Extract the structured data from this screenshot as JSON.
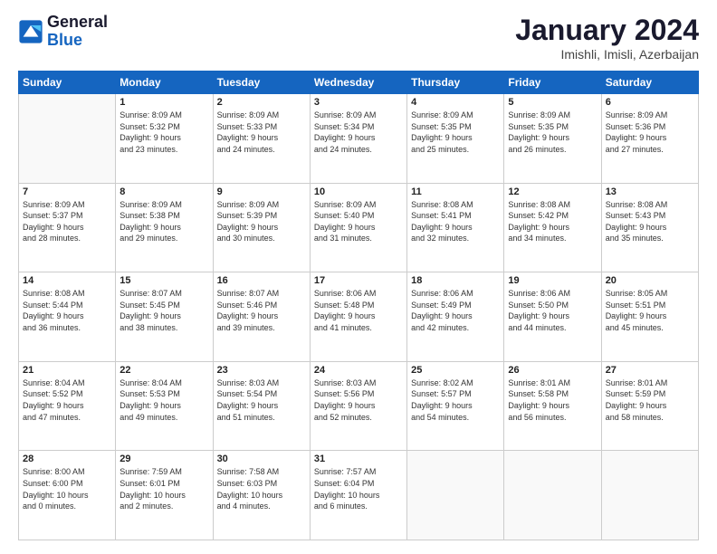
{
  "header": {
    "logo_general": "General",
    "logo_blue": "Blue",
    "month_title": "January 2024",
    "location": "Imishli, Imisli, Azerbaijan"
  },
  "days_of_week": [
    "Sunday",
    "Monday",
    "Tuesday",
    "Wednesday",
    "Thursday",
    "Friday",
    "Saturday"
  ],
  "weeks": [
    [
      {
        "day": "",
        "info": ""
      },
      {
        "day": "1",
        "info": "Sunrise: 8:09 AM\nSunset: 5:32 PM\nDaylight: 9 hours\nand 23 minutes."
      },
      {
        "day": "2",
        "info": "Sunrise: 8:09 AM\nSunset: 5:33 PM\nDaylight: 9 hours\nand 24 minutes."
      },
      {
        "day": "3",
        "info": "Sunrise: 8:09 AM\nSunset: 5:34 PM\nDaylight: 9 hours\nand 24 minutes."
      },
      {
        "day": "4",
        "info": "Sunrise: 8:09 AM\nSunset: 5:35 PM\nDaylight: 9 hours\nand 25 minutes."
      },
      {
        "day": "5",
        "info": "Sunrise: 8:09 AM\nSunset: 5:35 PM\nDaylight: 9 hours\nand 26 minutes."
      },
      {
        "day": "6",
        "info": "Sunrise: 8:09 AM\nSunset: 5:36 PM\nDaylight: 9 hours\nand 27 minutes."
      }
    ],
    [
      {
        "day": "7",
        "info": "Sunrise: 8:09 AM\nSunset: 5:37 PM\nDaylight: 9 hours\nand 28 minutes."
      },
      {
        "day": "8",
        "info": "Sunrise: 8:09 AM\nSunset: 5:38 PM\nDaylight: 9 hours\nand 29 minutes."
      },
      {
        "day": "9",
        "info": "Sunrise: 8:09 AM\nSunset: 5:39 PM\nDaylight: 9 hours\nand 30 minutes."
      },
      {
        "day": "10",
        "info": "Sunrise: 8:09 AM\nSunset: 5:40 PM\nDaylight: 9 hours\nand 31 minutes."
      },
      {
        "day": "11",
        "info": "Sunrise: 8:08 AM\nSunset: 5:41 PM\nDaylight: 9 hours\nand 32 minutes."
      },
      {
        "day": "12",
        "info": "Sunrise: 8:08 AM\nSunset: 5:42 PM\nDaylight: 9 hours\nand 34 minutes."
      },
      {
        "day": "13",
        "info": "Sunrise: 8:08 AM\nSunset: 5:43 PM\nDaylight: 9 hours\nand 35 minutes."
      }
    ],
    [
      {
        "day": "14",
        "info": "Sunrise: 8:08 AM\nSunset: 5:44 PM\nDaylight: 9 hours\nand 36 minutes."
      },
      {
        "day": "15",
        "info": "Sunrise: 8:07 AM\nSunset: 5:45 PM\nDaylight: 9 hours\nand 38 minutes."
      },
      {
        "day": "16",
        "info": "Sunrise: 8:07 AM\nSunset: 5:46 PM\nDaylight: 9 hours\nand 39 minutes."
      },
      {
        "day": "17",
        "info": "Sunrise: 8:06 AM\nSunset: 5:48 PM\nDaylight: 9 hours\nand 41 minutes."
      },
      {
        "day": "18",
        "info": "Sunrise: 8:06 AM\nSunset: 5:49 PM\nDaylight: 9 hours\nand 42 minutes."
      },
      {
        "day": "19",
        "info": "Sunrise: 8:06 AM\nSunset: 5:50 PM\nDaylight: 9 hours\nand 44 minutes."
      },
      {
        "day": "20",
        "info": "Sunrise: 8:05 AM\nSunset: 5:51 PM\nDaylight: 9 hours\nand 45 minutes."
      }
    ],
    [
      {
        "day": "21",
        "info": "Sunrise: 8:04 AM\nSunset: 5:52 PM\nDaylight: 9 hours\nand 47 minutes."
      },
      {
        "day": "22",
        "info": "Sunrise: 8:04 AM\nSunset: 5:53 PM\nDaylight: 9 hours\nand 49 minutes."
      },
      {
        "day": "23",
        "info": "Sunrise: 8:03 AM\nSunset: 5:54 PM\nDaylight: 9 hours\nand 51 minutes."
      },
      {
        "day": "24",
        "info": "Sunrise: 8:03 AM\nSunset: 5:56 PM\nDaylight: 9 hours\nand 52 minutes."
      },
      {
        "day": "25",
        "info": "Sunrise: 8:02 AM\nSunset: 5:57 PM\nDaylight: 9 hours\nand 54 minutes."
      },
      {
        "day": "26",
        "info": "Sunrise: 8:01 AM\nSunset: 5:58 PM\nDaylight: 9 hours\nand 56 minutes."
      },
      {
        "day": "27",
        "info": "Sunrise: 8:01 AM\nSunset: 5:59 PM\nDaylight: 9 hours\nand 58 minutes."
      }
    ],
    [
      {
        "day": "28",
        "info": "Sunrise: 8:00 AM\nSunset: 6:00 PM\nDaylight: 10 hours\nand 0 minutes."
      },
      {
        "day": "29",
        "info": "Sunrise: 7:59 AM\nSunset: 6:01 PM\nDaylight: 10 hours\nand 2 minutes."
      },
      {
        "day": "30",
        "info": "Sunrise: 7:58 AM\nSunset: 6:03 PM\nDaylight: 10 hours\nand 4 minutes."
      },
      {
        "day": "31",
        "info": "Sunrise: 7:57 AM\nSunset: 6:04 PM\nDaylight: 10 hours\nand 6 minutes."
      },
      {
        "day": "",
        "info": ""
      },
      {
        "day": "",
        "info": ""
      },
      {
        "day": "",
        "info": ""
      }
    ]
  ]
}
